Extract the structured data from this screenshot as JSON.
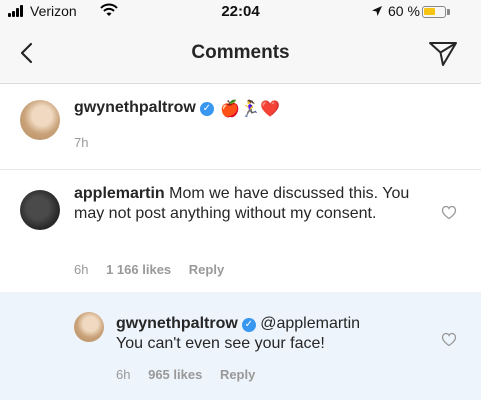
{
  "status_bar": {
    "carrier": "Verizon",
    "time": "22:04",
    "battery": "60 %",
    "battery_level": 0.6,
    "battery_color": "#f6c514"
  },
  "nav": {
    "title": "Comments",
    "back_icon": "chevron-left",
    "send_icon": "paper-plane"
  },
  "caption": {
    "username": "gwynethpaltrow",
    "emojis": "🍎🏃‍♀️❤️",
    "time": "7h"
  },
  "comments": [
    {
      "username": "applemartin",
      "text": "Mom we have discussed this. You may not post anything without my consent.",
      "time": "6h",
      "likes": "1 166 likes",
      "reply": "Reply"
    },
    {
      "username": "gwynethpaltrow",
      "mention": "@applemartin",
      "text": "You can't even see your face!",
      "time": "6h",
      "likes": "965 likes",
      "reply": "Reply"
    }
  ],
  "colors": {
    "verified_blue": "#3897f0",
    "reply_highlight": "#eef4fb"
  }
}
